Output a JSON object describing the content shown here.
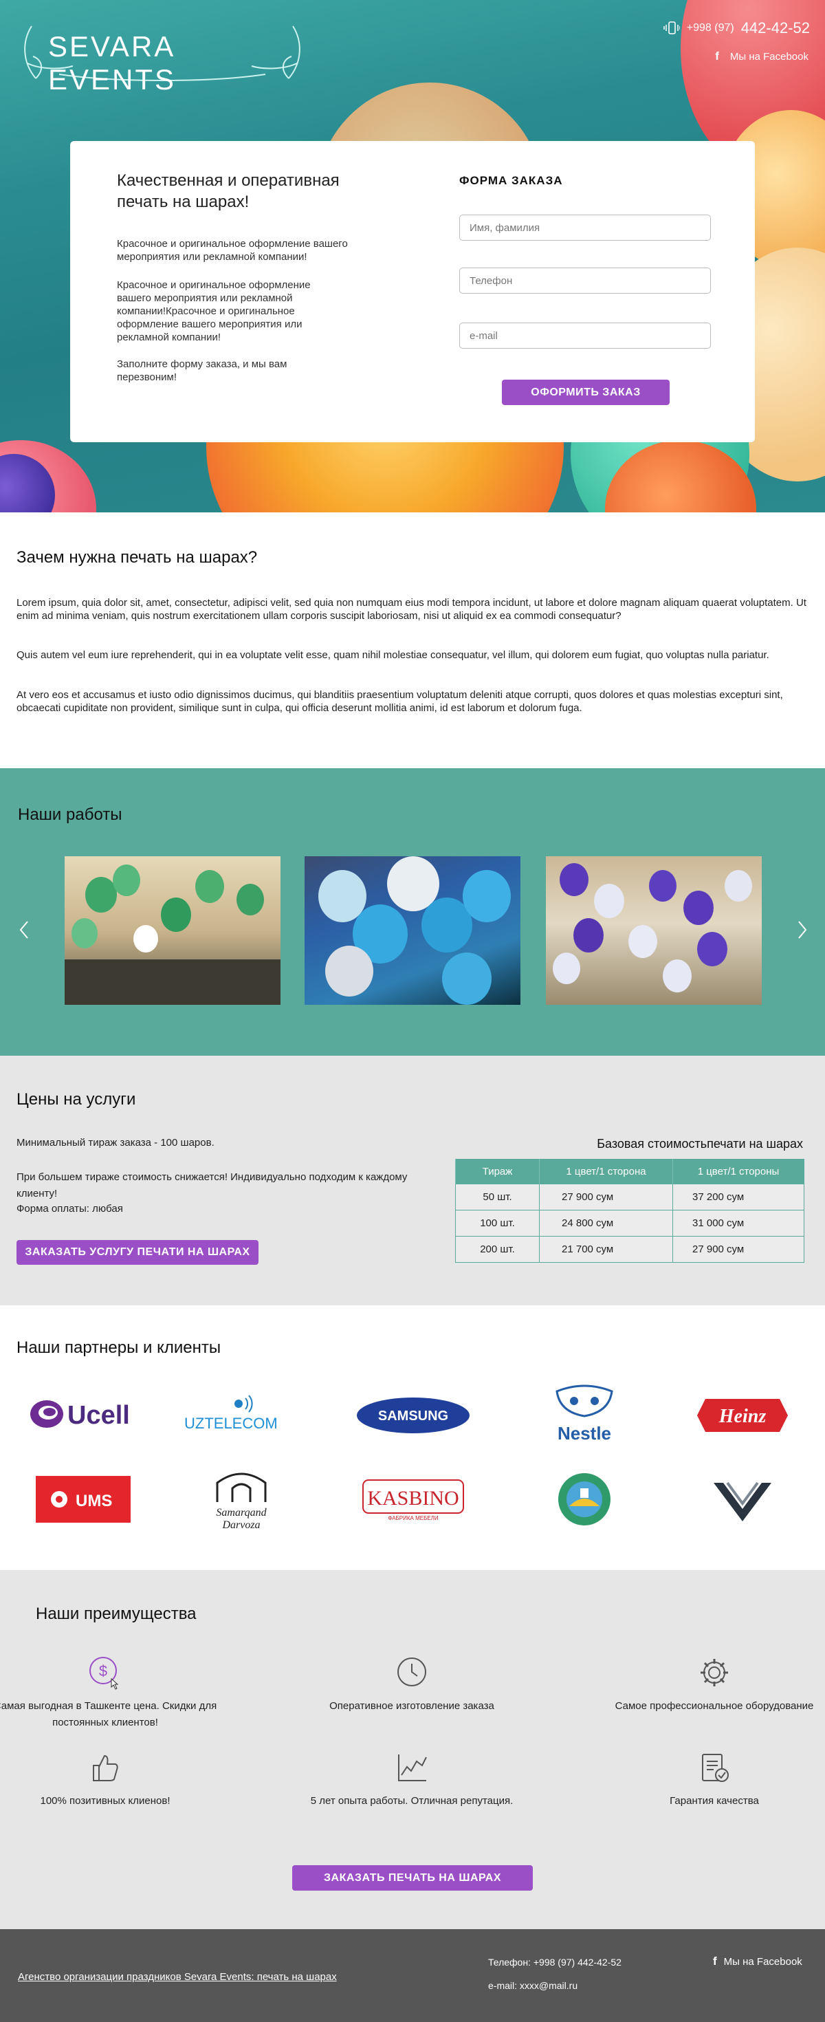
{
  "header": {
    "logo_text": "SEVARA EVENTS",
    "phone_prefix": "+998 (97)",
    "phone_number": "442-42-52",
    "facebook_label": "Мы на Facebook"
  },
  "hero": {
    "title": "Качественная и оперативная печать на шарах!",
    "p1": "Красочное и оригинальное оформление вашего мероприятия или рекламной компании!",
    "p2": "Красочное и оригинальное оформление вашего мероприятия или рекламной компании!Красочное и оригинальное оформление вашего мероприятия или рекламной компании!",
    "p3": "Заполните форму заказа, и мы вам перезвоним!",
    "form_title": "ФОРМА ЗАКАЗА",
    "name_placeholder": "Имя, фамилия",
    "phone_placeholder": "Телефон",
    "email_placeholder": "e-mail",
    "submit_label": "ОФОРМИТЬ ЗАКАЗ"
  },
  "why": {
    "title": "Зачем нужна печать на шарах?",
    "p1": "Lorem ipsum, quia dolor sit, amet, consectetur, adipisci velit, sed quia non numquam eius modi tempora incidunt, ut labore et dolore magnam aliquam quaerat voluptatem. Ut enim ad minima veniam, quis nostrum exercitationem ullam corporis suscipit laboriosam, nisi ut aliquid ex ea commodi consequatur?",
    "p2": "Quis autem vel eum iure reprehenderit, qui in ea voluptate velit esse, quam nihil molestiae consequatur, vel illum, qui dolorem eum fugiat, quo voluptas nulla pariatur.",
    "p3": "At vero eos et accusamus et iusto odio dignissimos ducimus, qui blanditiis praesentium voluptatum deleniti atque corrupti, quos dolores et quas molestias excepturi sint, obcaecati cupiditate non provident, similique sunt in culpa, qui officia deserunt mollitia animi, id est laborum et dolorum fuga."
  },
  "works": {
    "title": "Наши работы"
  },
  "prices": {
    "title": "Цены на услуги",
    "min_order": "Минимальный тираж заказа - 100 шаров.",
    "discount": "При большем тираже стоимость снижается! Индивидуально подходим к каждому клиенту!",
    "payment": "Форма оплаты: любая",
    "button_label": "ЗАКАЗАТЬ УСЛУГУ ПЕЧАТИ НА ШАРАХ",
    "table_title": "Базовая стоимостьпечати на шарах",
    "columns": [
      "Тираж",
      "1 цвет/1 сторона",
      "1 цвет/1 стороны"
    ],
    "rows": [
      [
        "50 шт.",
        "27 900 сум",
        "37 200 сум"
      ],
      [
        "100 шт.",
        "24 800 сум",
        "31 000 сум"
      ],
      [
        "200 шт.",
        "21 700 сум",
        "27 900 сум"
      ]
    ]
  },
  "partners": {
    "title": "Наши партнеры и клиенты",
    "logos": [
      "Ucell",
      "UZTELECOM",
      "SAMSUNG",
      "Nestle",
      "Heinz",
      "UMS",
      "Samarqand Darvoza",
      "KASBINO",
      "ФАБРИКА МЕБЕЛИ"
    ]
  },
  "advantages": {
    "title": "Наши преимущества",
    "items": [
      {
        "label": "Самая выгодная в Ташкенте цена. Скидки для постоянных клиентов!",
        "icon": "dollar-icon"
      },
      {
        "label": "Оперативное изготовление заказа",
        "icon": "clock-icon"
      },
      {
        "label": "Самое профессиональное оборудование",
        "icon": "gear-icon"
      },
      {
        "label": "100% позитивных клиенов!",
        "icon": "thumbs-up-icon"
      },
      {
        "label": "5 лет опыта работы. Отличная репутация.",
        "icon": "chart-icon"
      },
      {
        "label": "Гарантия качества",
        "icon": "clipboard-check-icon"
      }
    ],
    "button_label": "ЗАКАЗАТЬ ПЕЧАТЬ НА ШАРАХ"
  },
  "footer": {
    "agency_link": "Агенство организации праздников Sevara Events: печать на шарах",
    "phone": "Телефон: +998 (97) 442-42-52",
    "email": "e-mail: xxxx@mail.ru",
    "facebook_label": "Мы на Facebook"
  },
  "colors": {
    "accent_purple": "#9b4fc7",
    "teal": "#5aaa9b",
    "footer_gray": "#565656",
    "section_gray": "#e6e6e6"
  }
}
